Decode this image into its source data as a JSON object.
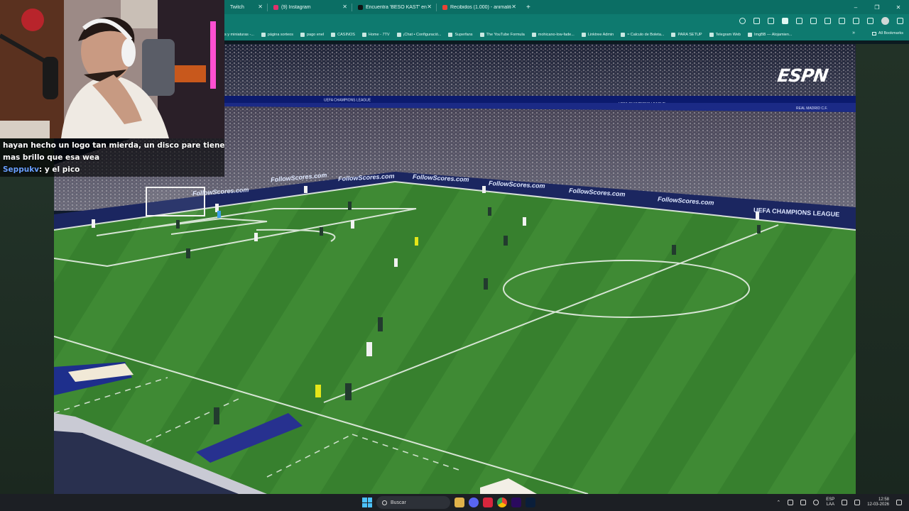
{
  "browser": {
    "tabs": [
      {
        "label": "Twitch",
        "color": "#9146ff"
      },
      {
        "label": "(9) Instagram",
        "color": "#e1306c"
      },
      {
        "label": "Encuentra 'BESO KAST' en TikTo",
        "color": "#111111"
      },
      {
        "label": "Recibidos (1.000) - animalitoo",
        "color": "#ea4335"
      }
    ],
    "new_tab_icon": "+",
    "window_controls": [
      "–",
      "❐",
      "✕"
    ],
    "bookmarks": [
      "s y miniaturas -...",
      "página sorteos",
      "pago enel",
      "CASINOS",
      "Home - 7TV",
      "¡Chat • Configuració...",
      "Superfans",
      "The YouTube Formula",
      "mohicano-low-fade...",
      "Linktree Admin",
      "≈ Calculo de Boleta...",
      "PARA SETUP",
      "Telegram Web",
      "ImgBB — Alojamien..."
    ],
    "bookmarks_more": "»",
    "all_bookmarks": "All Bookmarks"
  },
  "video": {
    "channel_logo": "ESPN",
    "board_texts": [
      "FollowScores.com",
      "FollowScores.com",
      "FollowScores.com",
      "FollowScores.com",
      "FollowScores.com",
      "FollowScores.com",
      "FollowScores.com"
    ],
    "ucl_text": "UEFA CHAMPIONS LEAGUE",
    "top_ribbon_texts": [
      "UEFA CHAMPIONS LEAGUE",
      "UEFA CHAMPIONS LEAGUE",
      "REAL MADRID C.F."
    ],
    "pitch_color": "#3f8a34",
    "board_color": "#1b2660"
  },
  "chat": {
    "lines": [
      {
        "user": "",
        "text": "hayan hecho un logo tan mierda, un disco pare tiene"
      },
      {
        "user": "",
        "text": "mas brillo que esa wea"
      },
      {
        "user": "Seppukv",
        "text": ": y el pico"
      }
    ]
  },
  "taskbar": {
    "search_placeholder": "Buscar",
    "language": [
      "ESP",
      "LAA"
    ],
    "time": "12:58",
    "date": "12-03-2026"
  }
}
